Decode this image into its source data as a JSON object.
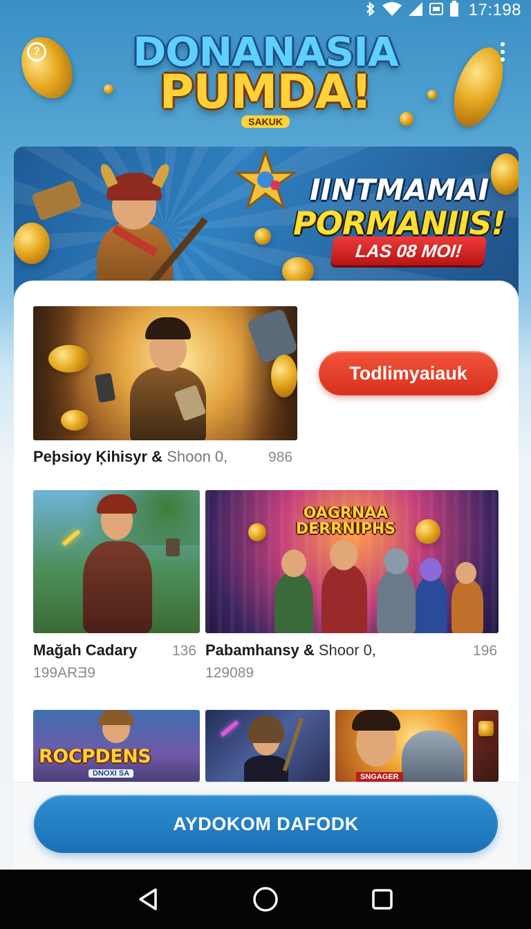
{
  "status_bar": {
    "time": "17:198",
    "icons": [
      "bluetooth-icon",
      "wifi-icon",
      "signal-icon",
      "sim-icon",
      "battery-icon"
    ]
  },
  "header": {
    "help_icon": "help-icon",
    "menu_icon": "more-vertical-icon",
    "logo_line1": "DONANASIA",
    "logo_line2": "PUMDA!",
    "logo_sub": "SAKUK"
  },
  "promo": {
    "title_1": "IINTMAMAI",
    "title_2": "PORMANIIS!",
    "badge": "LAS 08 MOI!"
  },
  "featured": {
    "play_label": "Todlimyaiauk",
    "title": "Peþsioy Ķihisyr &",
    "meta": "Shoon 0,",
    "count": "986"
  },
  "games": [
    {
      "title": "Mağah Cadary",
      "count": "136",
      "sub": "199ARƎ9"
    },
    {
      "title": "Pabamhansy &",
      "meta": "Shoor 0,",
      "count": "196",
      "sub": "129089",
      "art_title": "OAGRNAA DERRNIPHS"
    }
  ],
  "row3": {
    "thumb_1_title": "ROCPDENS",
    "thumb_1_sub": "DNOXI SA",
    "thumb_3_tag": "SNGAGER"
  },
  "cta": {
    "label": "AYDOKOM DAFODK"
  },
  "colors": {
    "accent_red": "#d8301c",
    "accent_blue": "#1b6fb5",
    "gold": "#ffd23a"
  }
}
